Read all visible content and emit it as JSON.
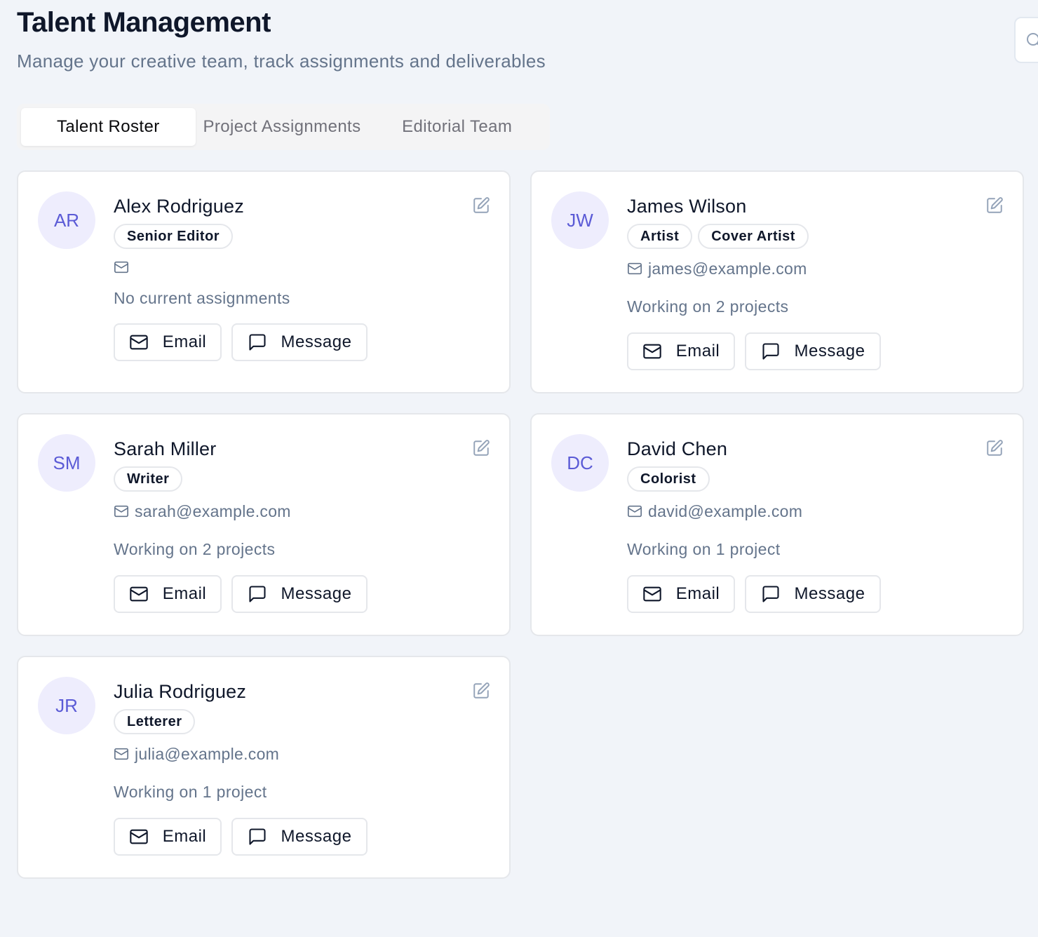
{
  "header": {
    "title": "Talent Management",
    "subtitle": "Manage your creative team, track assignments and deliverables"
  },
  "tabs": [
    {
      "label": "Talent Roster",
      "active": true
    },
    {
      "label": "Project Assignments",
      "active": false
    },
    {
      "label": "Editorial Team",
      "active": false
    }
  ],
  "talent": [
    {
      "initials": "AR",
      "name": "Alex Rodriguez",
      "roles": [
        "Senior Editor"
      ],
      "email": "",
      "status": "No current assignments",
      "email_button": "Email",
      "message_button": "Message"
    },
    {
      "initials": "JW",
      "name": "James Wilson",
      "roles": [
        "Artist",
        "Cover Artist"
      ],
      "email": "james@example.com",
      "status": "Working on 2 projects",
      "email_button": "Email",
      "message_button": "Message"
    },
    {
      "initials": "SM",
      "name": "Sarah Miller",
      "roles": [
        "Writer"
      ],
      "email": "sarah@example.com",
      "status": "Working on 2 projects",
      "email_button": "Email",
      "message_button": "Message"
    },
    {
      "initials": "DC",
      "name": "David Chen",
      "roles": [
        "Colorist"
      ],
      "email": "david@example.com",
      "status": "Working on 1 project",
      "email_button": "Email",
      "message_button": "Message"
    },
    {
      "initials": "JR",
      "name": "Julia Rodriguez",
      "roles": [
        "Letterer"
      ],
      "email": "julia@example.com",
      "status": "Working on 1 project",
      "email_button": "Email",
      "message_button": "Message"
    }
  ],
  "icons": {
    "edit": "edit-icon",
    "mail": "mail-icon",
    "message": "message-square-icon"
  },
  "colors": {
    "background": "#f1f4f9",
    "avatar_bg": "#eeedfd",
    "avatar_text": "#5b5bd6",
    "muted_text": "#64748b"
  }
}
